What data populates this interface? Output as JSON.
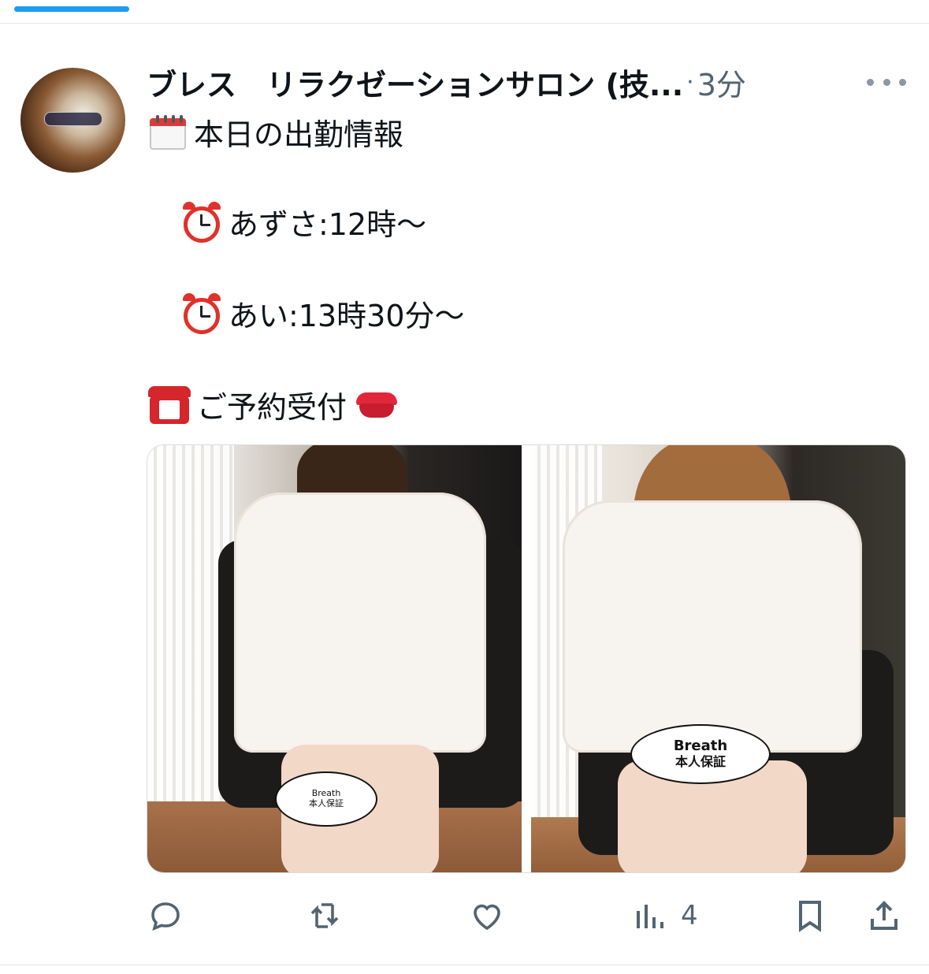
{
  "tweet": {
    "author_name": "ブレス　リラクゼーションサロン (技...",
    "separator": "·",
    "time": "3分",
    "lines": [
      {
        "text": "本日の出勤情報",
        "icon": "calendar-icon"
      },
      {
        "text": "あずさ:12時〜",
        "icon": "alarm-clock-icon"
      },
      {
        "text": "あい:13時30分〜",
        "icon": "alarm-clock-icon"
      },
      {
        "text": "ご予約受付",
        "icon": "telephone-icon",
        "trailing_icon": "lips-icon"
      }
    ],
    "images": [
      {
        "stamp_line1": "Breath",
        "stamp_line2": "本人保証"
      },
      {
        "stamp_line1": "Breath",
        "stamp_line2": "本人保証"
      }
    ]
  },
  "actions": {
    "reply": "reply-icon",
    "retweet": "retweet-icon",
    "like": "heart-icon",
    "views": "views-icon",
    "views_count": "4",
    "bookmark": "bookmark-icon",
    "share": "share-icon"
  },
  "colors": {
    "accent": "#1d9bf0",
    "text_primary": "#0f1419",
    "text_secondary": "#536471"
  }
}
